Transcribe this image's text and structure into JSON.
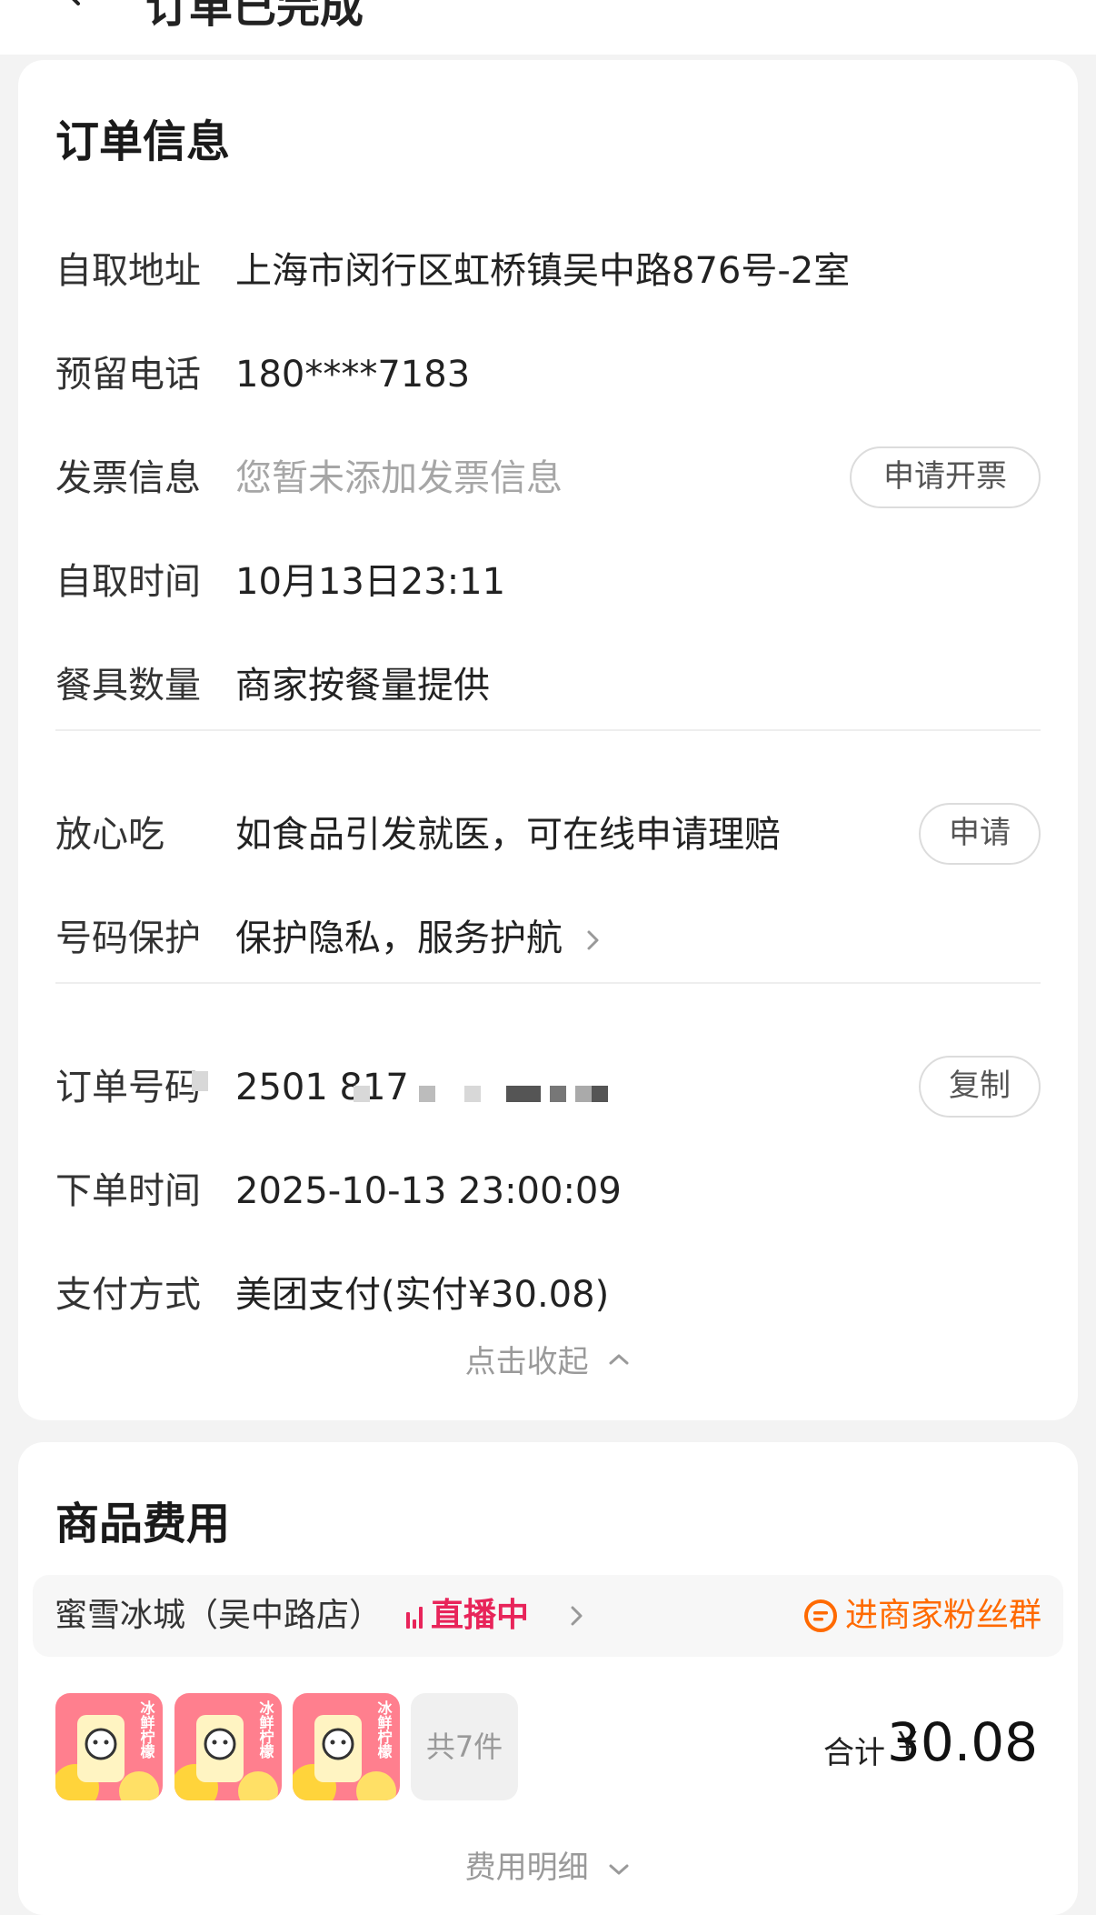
{
  "header": {
    "title": "订单已完成"
  },
  "order_info": {
    "title": "订单信息",
    "pickup_address": {
      "label": "自取地址",
      "value": "上海市闵行区虹桥镇吴中路876号-2室"
    },
    "phone": {
      "label": "预留电话",
      "value": "180****7183"
    },
    "invoice": {
      "label": "发票信息",
      "value": "您暂未添加发票信息",
      "button": "申请开票"
    },
    "pickup_time": {
      "label": "自取时间",
      "value": "10月13日23:11"
    },
    "tableware": {
      "label": "餐具数量",
      "value": "商家按餐量提供"
    },
    "safe_eat": {
      "label": "放心吃",
      "value": "如食品引发就医，可在线申请理赔",
      "button": "申请"
    },
    "number_protect": {
      "label": "号码保护",
      "value": "保护隐私，服务护航"
    },
    "order_no": {
      "label": "订单号码",
      "value": "2501 817",
      "button": "复制"
    },
    "order_time": {
      "label": "下单时间",
      "value": "2025-10-13 23:00:09"
    },
    "payment": {
      "label": "支付方式",
      "value": "美团支付(实付¥30.08)"
    },
    "collapse": "点击收起"
  },
  "goods": {
    "title": "商品费用",
    "shop_name": "蜜雪冰城（吴中路店）",
    "live": "直播中",
    "fans_group": "进商家粉丝群",
    "product_caption": "冰鲜柠檬",
    "item_count": "共7件",
    "total_label": "合计",
    "currency": "¥",
    "total": "30.08",
    "detail_toggle": "费用明细"
  },
  "colors": {
    "live": "#e8245a",
    "fans": "#ff6a00",
    "muted": "#a6a6a6"
  }
}
